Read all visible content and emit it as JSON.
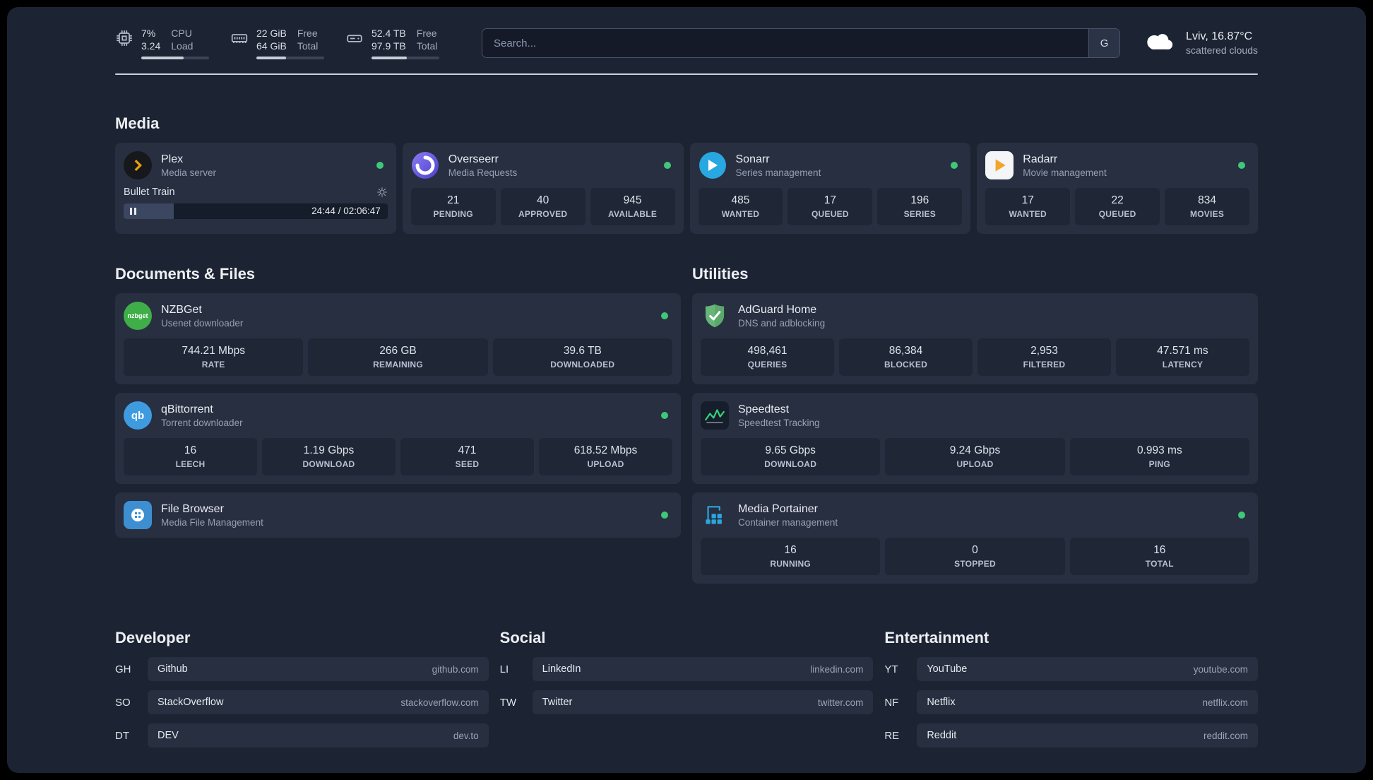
{
  "topbar": {
    "resources": [
      {
        "v1": "7%",
        "v2": "3.24",
        "l1": "CPU",
        "l2": "Load",
        "progress": 62
      },
      {
        "v1": "22 GiB",
        "v2": "64 GiB",
        "l1": "Free",
        "l2": "Total",
        "progress": 44
      },
      {
        "v1": "52.4 TB",
        "v2": "97.9 TB",
        "l1": "Free",
        "l2": "Total",
        "progress": 52
      }
    ],
    "search": {
      "placeholder": "Search...",
      "button_label": "G"
    },
    "weather": {
      "location": "Lviv, 16.87°C",
      "condition": "scattered clouds"
    }
  },
  "media": {
    "title": "Media",
    "cards": [
      {
        "name": "Plex",
        "desc": "Media server",
        "online": true,
        "player": {
          "track": "Bullet Train",
          "time": "24:44 / 02:06:47",
          "progress": 19
        }
      },
      {
        "name": "Overseerr",
        "desc": "Media Requests",
        "online": true,
        "stats": [
          {
            "value": "21",
            "label": "PENDING"
          },
          {
            "value": "40",
            "label": "APPROVED"
          },
          {
            "value": "945",
            "label": "AVAILABLE"
          }
        ]
      },
      {
        "name": "Sonarr",
        "desc": "Series management",
        "online": true,
        "stats": [
          {
            "value": "485",
            "label": "WANTED"
          },
          {
            "value": "17",
            "label": "QUEUED"
          },
          {
            "value": "196",
            "label": "SERIES"
          }
        ]
      },
      {
        "name": "Radarr",
        "desc": "Movie management",
        "online": true,
        "stats": [
          {
            "value": "17",
            "label": "WANTED"
          },
          {
            "value": "22",
            "label": "QUEUED"
          },
          {
            "value": "834",
            "label": "MOVIES"
          }
        ]
      }
    ]
  },
  "documents": {
    "title": "Documents & Files",
    "cards": [
      {
        "name": "NZBGet",
        "desc": "Usenet downloader",
        "online": true,
        "stats": [
          {
            "value": "744.21 Mbps",
            "label": "RATE"
          },
          {
            "value": "266 GB",
            "label": "REMAINING"
          },
          {
            "value": "39.6 TB",
            "label": "DOWNLOADED"
          }
        ]
      },
      {
        "name": "qBittorrent",
        "desc": "Torrent downloader",
        "online": true,
        "stats": [
          {
            "value": "16",
            "label": "LEECH"
          },
          {
            "value": "1.19 Gbps",
            "label": "DOWNLOAD"
          },
          {
            "value": "471",
            "label": "SEED"
          },
          {
            "value": "618.52 Mbps",
            "label": "UPLOAD"
          }
        ]
      },
      {
        "name": "File Browser",
        "desc": "Media File Management",
        "online": true,
        "stats": []
      }
    ]
  },
  "utilities": {
    "title": "Utilities",
    "cards": [
      {
        "name": "AdGuard Home",
        "desc": "DNS and adblocking",
        "online": false,
        "stats": [
          {
            "value": "498,461",
            "label": "QUERIES"
          },
          {
            "value": "86,384",
            "label": "BLOCKED"
          },
          {
            "value": "2,953",
            "label": "FILTERED"
          },
          {
            "value": "47.571 ms",
            "label": "LATENCY"
          }
        ]
      },
      {
        "name": "Speedtest",
        "desc": "Speedtest Tracking",
        "online": false,
        "stats": [
          {
            "value": "9.65 Gbps",
            "label": "DOWNLOAD"
          },
          {
            "value": "9.24 Gbps",
            "label": "UPLOAD"
          },
          {
            "value": "0.993 ms",
            "label": "PING"
          }
        ]
      },
      {
        "name": "Media Portainer",
        "desc": "Container management",
        "online": true,
        "stats": [
          {
            "value": "16",
            "label": "RUNNING"
          },
          {
            "value": "0",
            "label": "STOPPED"
          },
          {
            "value": "16",
            "label": "TOTAL"
          }
        ]
      }
    ]
  },
  "bookmarks": [
    {
      "title": "Developer",
      "items": [
        {
          "abbr": "GH",
          "name": "Github",
          "url": "github.com"
        },
        {
          "abbr": "SO",
          "name": "StackOverflow",
          "url": "stackoverflow.com"
        },
        {
          "abbr": "DT",
          "name": "DEV",
          "url": "dev.to"
        }
      ]
    },
    {
      "title": "Social",
      "items": [
        {
          "abbr": "LI",
          "name": "LinkedIn",
          "url": "linkedin.com"
        },
        {
          "abbr": "TW",
          "name": "Twitter",
          "url": "twitter.com"
        }
      ]
    },
    {
      "title": "Entertainment",
      "items": [
        {
          "abbr": "YT",
          "name": "YouTube",
          "url": "youtube.com"
        },
        {
          "abbr": "NF",
          "name": "Netflix",
          "url": "netflix.com"
        },
        {
          "abbr": "RE",
          "name": "Reddit",
          "url": "reddit.com"
        }
      ]
    }
  ],
  "colors": {
    "status_online": "#3fc878",
    "plex_accent": "#e5a00d",
    "page_background": "#1c2433",
    "card_background": "#272f41"
  }
}
